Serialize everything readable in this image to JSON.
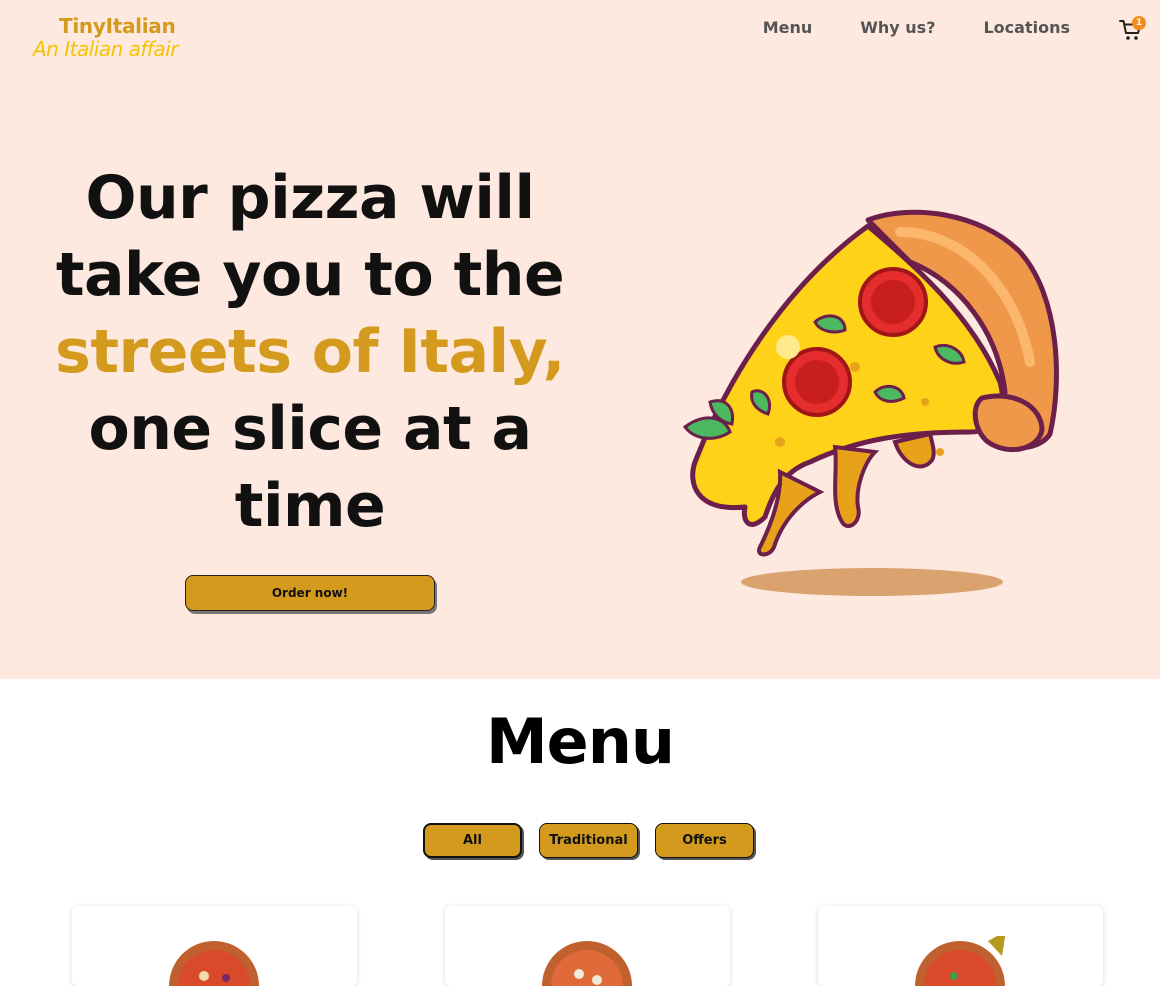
{
  "brand": {
    "name": "TinyItalian",
    "tagline": "An Italian affair"
  },
  "nav": {
    "items": [
      "Menu",
      "Why us?",
      "Locations"
    ],
    "cart_count": "1",
    "cart_icon": "cart-icon"
  },
  "hero": {
    "line1": "Our pizza will",
    "line2": "take you to the",
    "line3": "streets of Italy,",
    "line4": "one slice at a",
    "line5": "time",
    "cta": "Order now!",
    "image": "pizza-slice-illustration"
  },
  "menu": {
    "title": "Menu",
    "filters": [
      "All",
      "Traditional",
      "Offers"
    ],
    "cards": [
      "pizza-1",
      "pizza-2",
      "pizza-3"
    ]
  },
  "colors": {
    "accent": "#d39a1e",
    "tagline": "#f5c400",
    "hero_bg": "#fde9df",
    "badge": "#f28c1b"
  }
}
